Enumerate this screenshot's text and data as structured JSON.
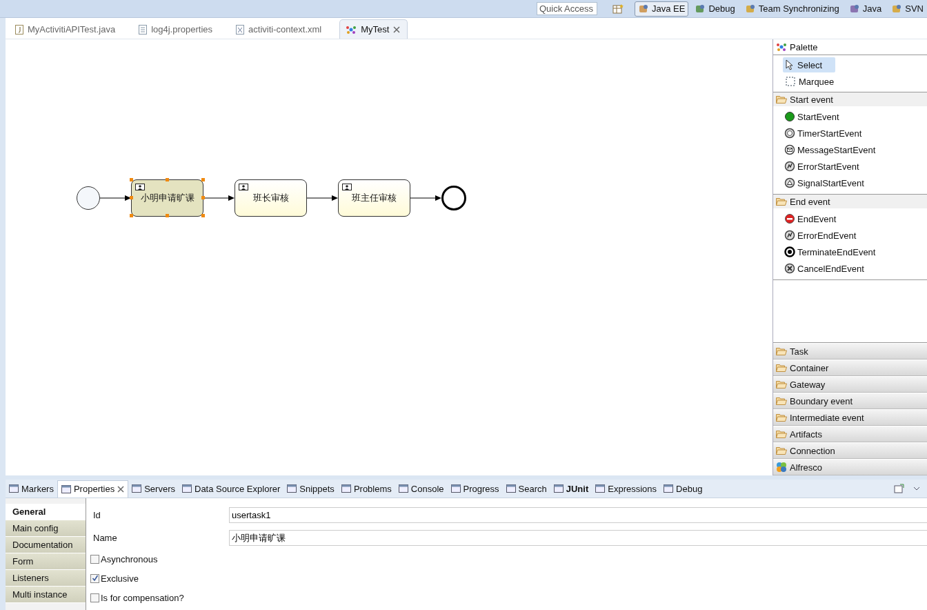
{
  "perspective_bar": {
    "quick_access": {
      "placeholder": "Quick Access"
    },
    "perspectives": [
      {
        "label": "Java EE",
        "kind": "javaee",
        "selected": true
      },
      {
        "label": "Debug",
        "kind": "debug",
        "selected": false
      },
      {
        "label": "Team Synchronizing",
        "kind": "team",
        "selected": false
      },
      {
        "label": "Java",
        "kind": "java",
        "selected": false
      },
      {
        "label": "SVN",
        "kind": "svn",
        "selected": false
      }
    ]
  },
  "editor_tabs": [
    {
      "label": "MyActivitiAPITest.java",
      "kind": "java",
      "selected": false
    },
    {
      "label": "log4j.properties",
      "kind": "text",
      "selected": false
    },
    {
      "label": "activiti-context.xml",
      "kind": "xml",
      "selected": false
    },
    {
      "label": "MyTest",
      "kind": "diagram",
      "selected": true
    }
  ],
  "diagram": {
    "nodes": [
      {
        "kind": "start"
      },
      {
        "kind": "task",
        "label": "小明申请旷课",
        "selected": true
      },
      {
        "kind": "task",
        "label": "班长审核",
        "selected": false
      },
      {
        "kind": "task",
        "label": "班主任审核",
        "selected": false
      },
      {
        "kind": "end"
      }
    ]
  },
  "palette": {
    "title": "Palette",
    "tools": [
      {
        "label": "Select",
        "kind": "select",
        "selected": true
      },
      {
        "label": "Marquee",
        "kind": "marquee",
        "selected": false
      }
    ],
    "drawers": [
      {
        "label": "Start event",
        "kind": "folder",
        "expanded": true,
        "items": [
          {
            "label": "StartEvent",
            "kind": "start"
          },
          {
            "label": "TimerStartEvent",
            "kind": "timer"
          },
          {
            "label": "MessageStartEvent",
            "kind": "message"
          },
          {
            "label": "ErrorStartEvent",
            "kind": "error"
          },
          {
            "label": "SignalStartEvent",
            "kind": "signal"
          }
        ]
      },
      {
        "label": "End event",
        "kind": "folder",
        "expanded": true,
        "items": [
          {
            "label": "EndEvent",
            "kind": "end"
          },
          {
            "label": "ErrorEndEvent",
            "kind": "error"
          },
          {
            "label": "TerminateEndEvent",
            "kind": "terminate"
          },
          {
            "label": "CancelEndEvent",
            "kind": "cancel"
          }
        ]
      },
      {
        "label": "Task",
        "kind": "folder",
        "expanded": false
      },
      {
        "label": "Container",
        "kind": "folder",
        "expanded": false
      },
      {
        "label": "Gateway",
        "kind": "folder",
        "expanded": false
      },
      {
        "label": "Boundary event",
        "kind": "folder",
        "expanded": false
      },
      {
        "label": "Intermediate event",
        "kind": "folder",
        "expanded": false
      },
      {
        "label": "Artifacts",
        "kind": "folder",
        "expanded": false
      },
      {
        "label": "Connection",
        "kind": "folder",
        "expanded": false
      },
      {
        "label": "Alfresco",
        "kind": "alfresco",
        "expanded": false
      }
    ]
  },
  "view_tabs": [
    {
      "label": "Markers",
      "selected": false,
      "highlighted": false
    },
    {
      "label": "Properties",
      "selected": true,
      "highlighted": false
    },
    {
      "label": "Servers",
      "selected": false,
      "highlighted": false
    },
    {
      "label": "Data Source Explorer",
      "selected": false,
      "highlighted": false
    },
    {
      "label": "Snippets",
      "selected": false,
      "highlighted": false
    },
    {
      "label": "Problems",
      "selected": false,
      "highlighted": false
    },
    {
      "label": "Console",
      "selected": false,
      "highlighted": false
    },
    {
      "label": "Progress",
      "selected": false,
      "highlighted": false
    },
    {
      "label": "Search",
      "selected": false,
      "highlighted": false
    },
    {
      "label": "JUnit",
      "selected": false,
      "highlighted": true
    },
    {
      "label": "Expressions",
      "selected": false,
      "highlighted": false
    },
    {
      "label": "Debug",
      "selected": false,
      "highlighted": false
    }
  ],
  "properties": {
    "sections": [
      {
        "label": "General",
        "selected": true
      },
      {
        "label": "Main config",
        "selected": false
      },
      {
        "label": "Documentation",
        "selected": false
      },
      {
        "label": "Form",
        "selected": false
      },
      {
        "label": "Listeners",
        "selected": false
      },
      {
        "label": "Multi instance",
        "selected": false
      }
    ],
    "fields": [
      {
        "label": "Id",
        "value": "usertask1"
      },
      {
        "label": "Name",
        "value": "小明申请旷课"
      }
    ],
    "checkboxes": [
      {
        "label": "Asynchronous",
        "checked": false
      },
      {
        "label": "Exclusive",
        "checked": true
      },
      {
        "label": "Is for compensation?",
        "checked": false
      }
    ]
  }
}
